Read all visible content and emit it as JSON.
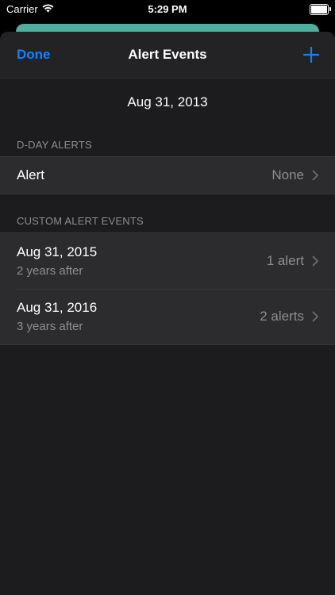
{
  "status_bar": {
    "carrier": "Carrier",
    "time": "5:29 PM"
  },
  "nav": {
    "done_label": "Done",
    "title": "Alert Events",
    "add_icon": "plus-icon"
  },
  "date_header": "Aug 31, 2013",
  "dday_section": {
    "header": "D-DAY ALERTS",
    "rows": [
      {
        "title": "Alert",
        "value": "None"
      }
    ]
  },
  "custom_section": {
    "header": "CUSTOM ALERT EVENTS",
    "rows": [
      {
        "title": "Aug 31, 2015",
        "subtitle": "2 years after",
        "value": "1 alert"
      },
      {
        "title": "Aug 31, 2016",
        "subtitle": "3 years after",
        "value": "2 alerts"
      }
    ]
  },
  "colors": {
    "accent": "#0a84ff",
    "sheet_bg": "#1c1c1e",
    "cell_bg": "#2c2c2e",
    "secondary_text": "#8d8d93",
    "peek_green": "#4fae9e"
  }
}
